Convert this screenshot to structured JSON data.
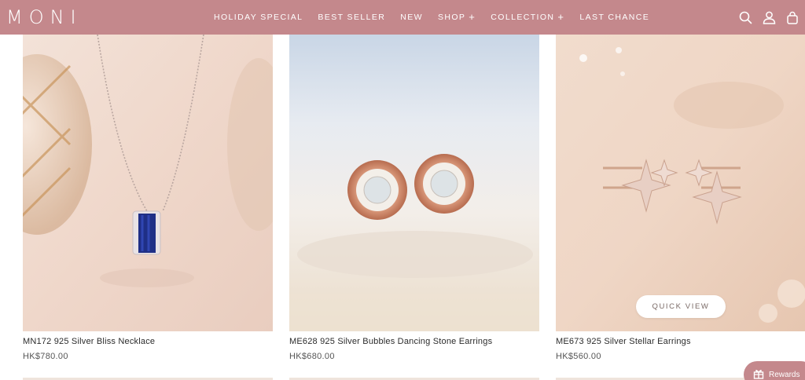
{
  "brand": {
    "logo": "MONI",
    "color": "#c4888c"
  },
  "nav": [
    {
      "label": "HOLIDAY SPECIAL",
      "has_submenu": false
    },
    {
      "label": "BEST SELLER",
      "has_submenu": false
    },
    {
      "label": "NEW",
      "has_submenu": false
    },
    {
      "label": "SHOP",
      "has_submenu": true
    },
    {
      "label": "COLLECTION",
      "has_submenu": true
    },
    {
      "label": "LAST CHANCE",
      "has_submenu": false
    }
  ],
  "header_icons": [
    "search-icon",
    "account-icon",
    "cart-icon"
  ],
  "products": [
    {
      "name": "MN172 925 Silver Bliss Necklace",
      "price": "HK$780.00"
    },
    {
      "name": "ME628 925 Silver Bubbles Dancing Stone Earrings",
      "price": "HK$680.00"
    },
    {
      "name": "ME673 925 Silver Stellar Earrings",
      "price": "HK$560.00"
    }
  ],
  "quick_view_label": "QUICK VIEW",
  "rewards": {
    "label": "Rewards"
  }
}
